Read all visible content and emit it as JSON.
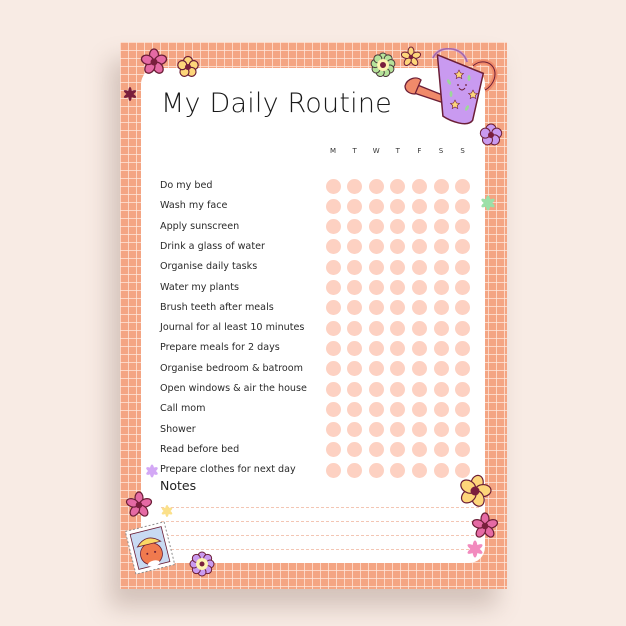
{
  "document": {
    "title": "My Daily Routine",
    "days": [
      "M",
      "T",
      "W",
      "T",
      "F",
      "S",
      "S"
    ],
    "tasks": [
      "Do my bed",
      "Wash my face",
      "Apply sunscreen",
      "Drink a glass of water",
      "Organise daily tasks",
      "Water my plants",
      "Brush teeth after meals",
      "Journal for al least 10 minutes",
      "Prepare meals for 2 days",
      "Organise bedroom & batroom",
      "Open windows & air the house",
      "Call mom",
      "Shower",
      "Read before bed",
      "Prepare clothes for next day"
    ],
    "checked": [],
    "notes": {
      "label": "Notes",
      "line_count": 4,
      "value": ""
    }
  },
  "colors": {
    "background": "#F8EBE4",
    "grid": "#F4A583",
    "panel": "#FFFFFF",
    "dot": "#FDD1C2",
    "text": "#2A2A2A"
  },
  "decorations": [
    "pink-flower-icon",
    "yellow-flower-icon",
    "maroon-asterisk-icon",
    "green-flower-icon",
    "small-yellow-flower-icon",
    "watering-can-icon",
    "purple-flower-icon",
    "green-asterisk-icon",
    "lilac-asterisk-icon",
    "yellow-flower-large-icon",
    "pink-flower-right-icon",
    "pink-asterisk-icon",
    "pink-flower-left-icon",
    "yellow-asterisk-icon",
    "bear-stamp-icon",
    "purple-daisy-icon"
  ]
}
